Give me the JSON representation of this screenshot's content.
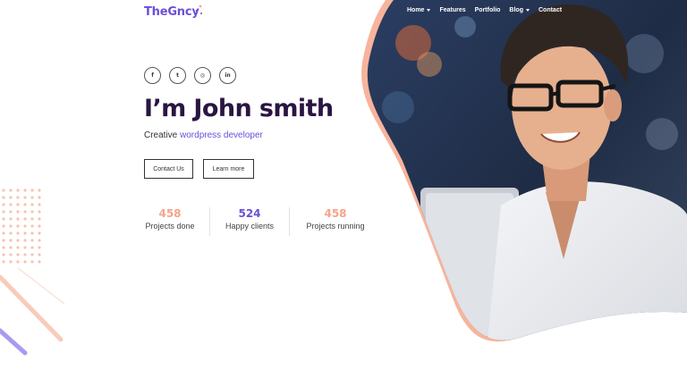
{
  "header": {
    "logo": "TheGncy",
    "nav": [
      {
        "label": "Home",
        "dropdown": true
      },
      {
        "label": "Features",
        "dropdown": false
      },
      {
        "label": "Portfolio",
        "dropdown": false
      },
      {
        "label": "Blog",
        "dropdown": true
      },
      {
        "label": "Contact",
        "dropdown": false
      }
    ]
  },
  "social": [
    {
      "icon": "facebook-icon",
      "glyph": "f"
    },
    {
      "icon": "twitter-icon",
      "glyph": "t"
    },
    {
      "icon": "dribbble-icon",
      "glyph": "◎"
    },
    {
      "icon": "linkedin-icon",
      "glyph": "in"
    }
  ],
  "hero": {
    "headline": "I’m John smith",
    "subline_prefix": "Creative ",
    "subline_accent": "wordpress developer",
    "contact_button": "Contact Us",
    "learn_button": "Learn more"
  },
  "stats": [
    {
      "value": "458",
      "label": "Projects done",
      "color": "#f5a48a"
    },
    {
      "value": "524",
      "label": "Happy clients",
      "color": "#6b4fd8"
    },
    {
      "value": "458",
      "label": "Projects running",
      "color": "#f5a48a"
    }
  ],
  "colors": {
    "brand": "#6b4fd8",
    "accent": "#f5a48a",
    "headline": "#2a1542"
  }
}
